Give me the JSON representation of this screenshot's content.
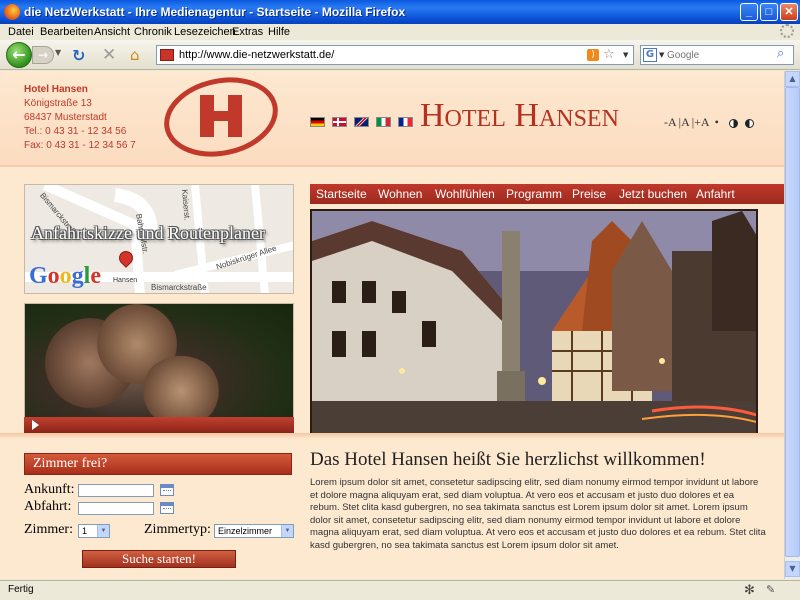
{
  "window": {
    "title": "die NetzWerkstatt - Ihre Medienagentur - Startseite - Mozilla Firefox"
  },
  "menu": {
    "items": [
      "Datei",
      "Bearbeiten",
      "Ansicht",
      "Chronik",
      "Lesezeichen",
      "Extras",
      "Hilfe"
    ]
  },
  "toolbar": {
    "url": "http://www.die-netzwerkstatt.de/",
    "search_placeholder": "Google"
  },
  "hotel": {
    "name": "Hotel Hansen",
    "street": "Königstraße 13",
    "city": "68437 Musterstadt",
    "phone": "Tel.: 0 43 31 - 12 34 56",
    "fax": "Fax: 0 43 31 - 12 34 56 7",
    "title": "Hotel Hansen",
    "brand_color": "#c0392b"
  },
  "languages": [
    "de",
    "dk",
    "gb",
    "it",
    "fr"
  ],
  "font_controls": [
    "-A",
    "A",
    "+A"
  ],
  "map": {
    "title": "Anfahrtskizze und Routenplaner",
    "provider": "Google",
    "pin_label": "Hansen",
    "streets": [
      "Bismarckstraße",
      "Bismarckstraße",
      "Nobiskrüger Allee",
      "Bahnhofstr.",
      "Kaiserst."
    ]
  },
  "nav": {
    "items": [
      "Startseite",
      "Wohnen",
      "Wohlfühlen",
      "Programm",
      "Preise",
      "Jetzt buchen",
      "Anfahrt"
    ]
  },
  "booking": {
    "header": "Zimmer frei?",
    "arrival_label": "Ankunft:",
    "departure_label": "Abfahrt:",
    "rooms_label": "Zimmer:",
    "rooms_value": "1",
    "roomtype_label": "Zimmertyp:",
    "roomtype_value": "Einzelzimmer",
    "search_button": "Suche starten!"
  },
  "welcome": {
    "title": "Das Hotel Hansen heißt Sie herzlichst willkommen!",
    "text": "Lorem ipsum dolor sit amet, consetetur sadipscing elitr, sed diam nonumy eirmod tempor invidunt ut labore et dolore magna aliquyam erat, sed diam voluptua. At vero eos et accusam et justo duo dolores et ea rebum. Stet clita kasd gubergren, no sea takimata sanctus est Lorem ipsum dolor sit amet. Lorem ipsum dolor sit amet, consetetur sadipscing elitr, sed diam nonumy eirmod tempor invidunt ut labore et dolore magna aliquyam erat, sed diam voluptua. At vero eos et accusam et justo duo dolores et ea rebum. Stet clita kasd gubergren, no sea takimata sanctus est Lorem ipsum dolor sit amet."
  },
  "status": {
    "text": "Fertig"
  }
}
